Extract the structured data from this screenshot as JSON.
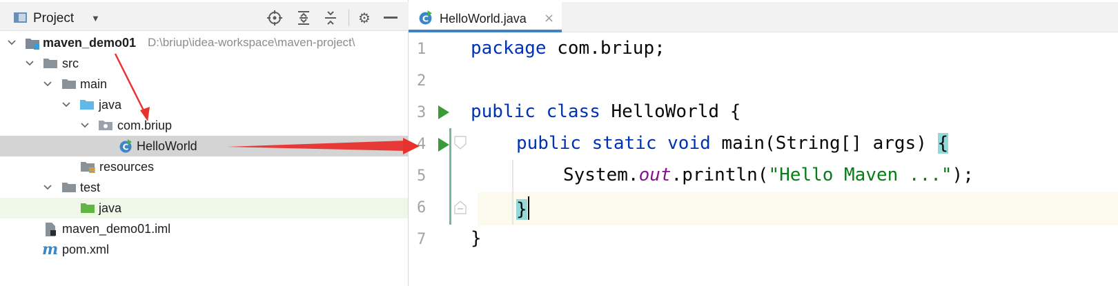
{
  "project_panel": {
    "title": "Project",
    "toolbar_icons": [
      "locate-icon",
      "expand-all-icon",
      "collapse-all-icon",
      "gear-icon",
      "minimize-icon"
    ],
    "tree": [
      {
        "label": "maven_demo01",
        "path": "D:\\briup\\idea-workspace\\maven-project\\",
        "bold": true,
        "icon": "module-folder-icon",
        "expanded": true
      },
      {
        "label": "src",
        "icon": "folder-icon",
        "expanded": true
      },
      {
        "label": "main",
        "icon": "folder-icon",
        "expanded": true
      },
      {
        "label": "java",
        "icon": "source-folder-icon",
        "expanded": true
      },
      {
        "label": "com.briup",
        "icon": "package-icon",
        "expanded": true
      },
      {
        "label": "HelloWorld",
        "icon": "java-class-icon",
        "selected": true
      },
      {
        "label": "resources",
        "icon": "resources-folder-icon"
      },
      {
        "label": "test",
        "icon": "folder-icon",
        "expanded": true
      },
      {
        "label": "java",
        "icon": "test-source-folder-icon",
        "hovered": true
      },
      {
        "label": "maven_demo01.iml",
        "icon": "iml-file-icon"
      },
      {
        "label": "pom.xml",
        "icon": "maven-icon"
      }
    ]
  },
  "editor": {
    "tab": {
      "label": "HelloWorld.java",
      "close": "×"
    },
    "line_numbers": [
      "1",
      "2",
      "3",
      "4",
      "5",
      "6",
      "7"
    ],
    "lines": [
      {
        "kw1": "package",
        "rest": " com.briup;"
      },
      {},
      {
        "kw1": "public",
        "kw2": "class",
        "rest": " HelloWorld {"
      },
      {
        "kw1": "public",
        "kw2": "static",
        "kw3": "void",
        "name": " main(String[] args) ",
        "brace": "{"
      },
      {
        "pre": "System.",
        "field": "out",
        "mid": ".println(",
        "str": "\"Hello Maven ...\"",
        "end": ");"
      },
      {
        "brace": "}"
      },
      {
        "rest": "}"
      }
    ]
  },
  "colors": {
    "keyword": "#0033b3",
    "string": "#067d17",
    "field": "#871094",
    "selection": "#d4d4d4",
    "brace_match": "#93d9d9",
    "arrow": "#e8322e",
    "run": "#3b9b3b",
    "tab_accent": "#4083c9"
  }
}
